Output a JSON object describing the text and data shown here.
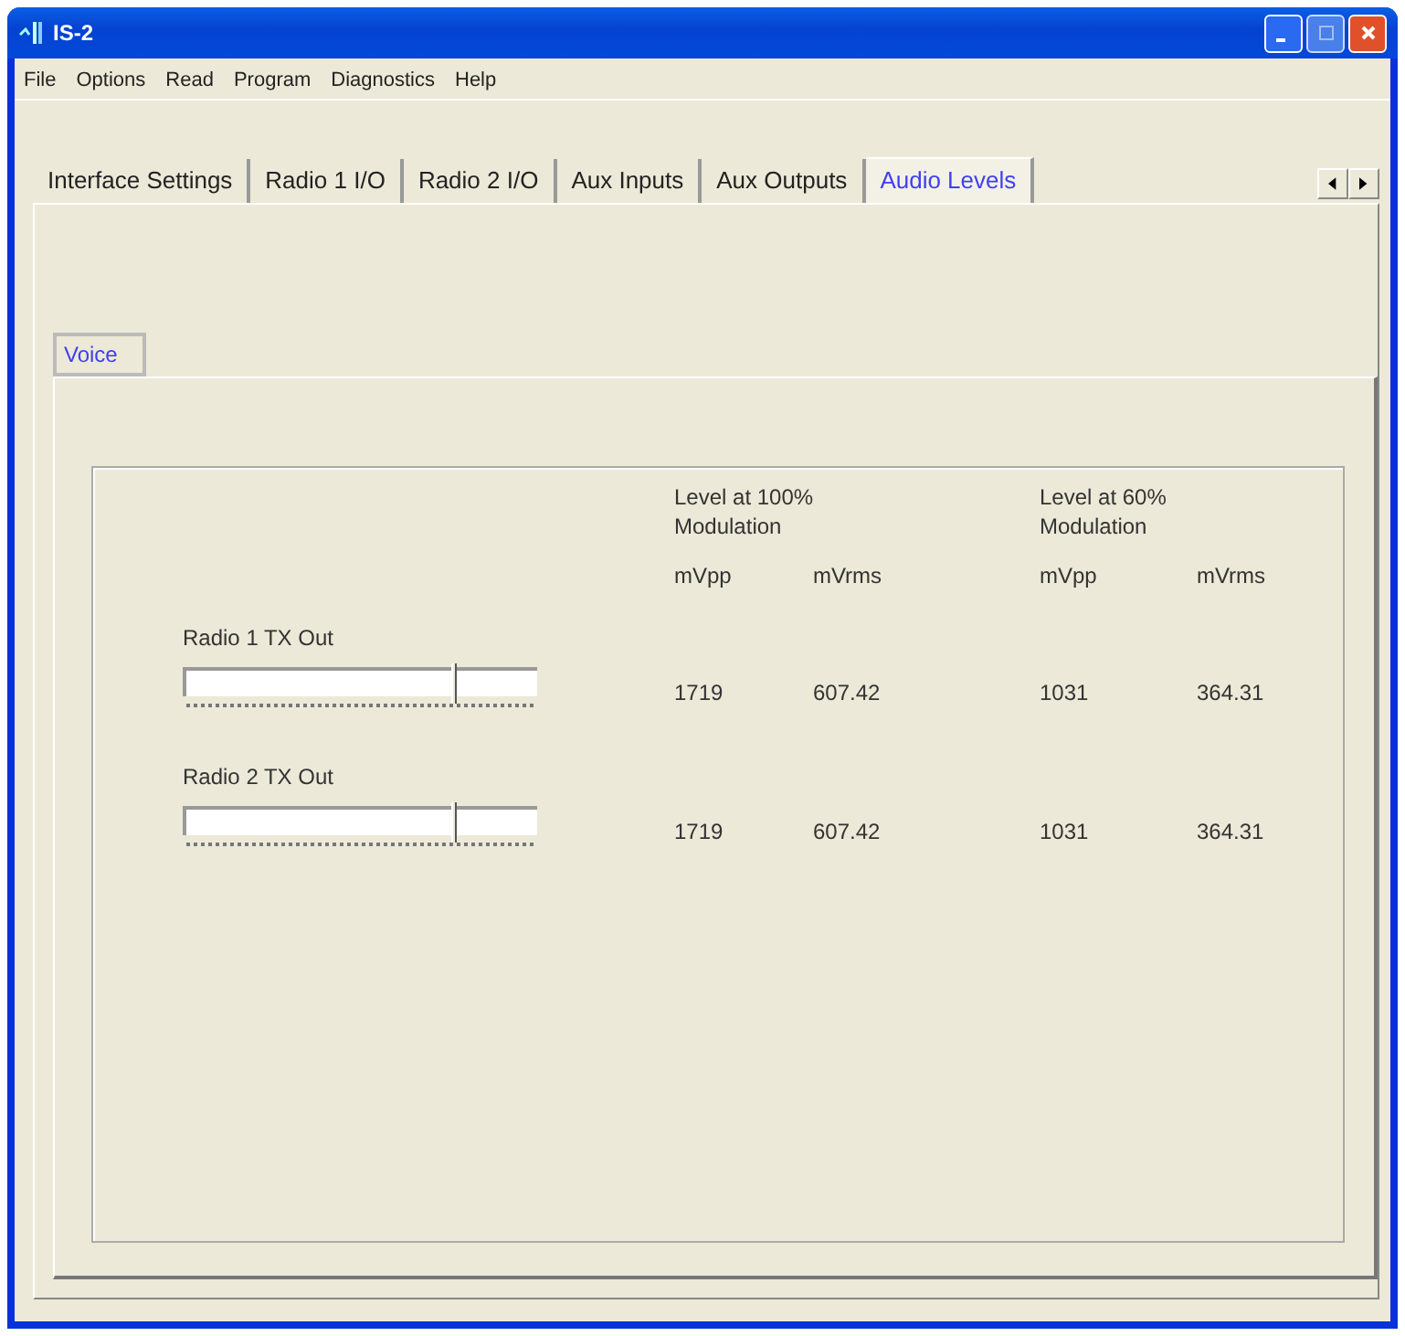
{
  "window": {
    "title": "IS-2"
  },
  "menu": [
    "File",
    "Options",
    "Read",
    "Program",
    "Diagnostics",
    "Help"
  ],
  "tabs": [
    {
      "label": "Interface Settings",
      "selected": false
    },
    {
      "label": "Radio 1 I/O",
      "selected": false
    },
    {
      "label": "Radio 2 I/O",
      "selected": false
    },
    {
      "label": "Aux Inputs",
      "selected": false
    },
    {
      "label": "Aux Outputs",
      "selected": false
    },
    {
      "label": "Audio Levels",
      "selected": true
    }
  ],
  "sub_tabs": [
    {
      "label": "Voice",
      "selected": true
    }
  ],
  "levels": {
    "headers": [
      "Level at 100%\nModulation",
      "Level at 60%\nModulation"
    ],
    "columns": [
      "mVpp",
      "mVrms",
      "mVpp",
      "mVrms"
    ],
    "channels": [
      {
        "name": "Radio 1 TX Out",
        "level": 0.76,
        "values": [
          "1719",
          "607.42",
          "1031",
          "364.31"
        ]
      },
      {
        "name": "Radio 2 TX Out",
        "level": 0.76,
        "values": [
          "1719",
          "607.42",
          "1031",
          "364.31"
        ]
      }
    ]
  }
}
